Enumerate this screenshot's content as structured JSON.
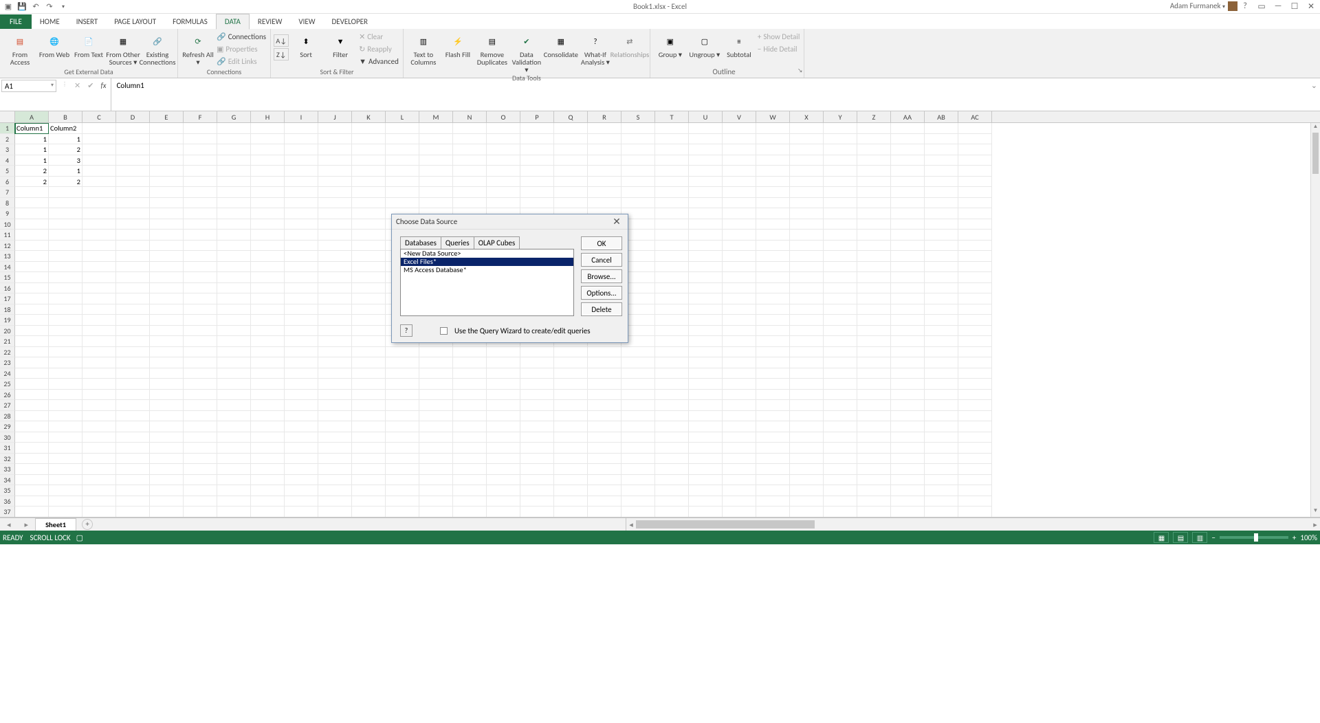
{
  "title": "Book1.xlsx - Excel",
  "user": "Adam Furmanek",
  "tabs": [
    "FILE",
    "HOME",
    "INSERT",
    "PAGE LAYOUT",
    "FORMULAS",
    "DATA",
    "REVIEW",
    "VIEW",
    "DEVELOPER"
  ],
  "activeTab": "DATA",
  "ribbon": {
    "getext": {
      "label": "Get External Data",
      "btns": [
        "From Access",
        "From Web",
        "From Text",
        "From Other Sources ▾",
        "Existing Connections"
      ]
    },
    "conn": {
      "label": "Connections",
      "refresh": "Refresh All ▾",
      "items": [
        "Connections",
        "Properties",
        "Edit Links"
      ]
    },
    "sort": {
      "label": "Sort & Filter",
      "sort": "Sort",
      "filter": "Filter",
      "items": [
        "Clear",
        "Reapply",
        "Advanced"
      ]
    },
    "tools": {
      "label": "Data Tools",
      "btns": [
        "Text to Columns",
        "Flash Fill",
        "Remove Duplicates",
        "Data Validation ▾",
        "Consolidate",
        "What-If Analysis ▾",
        "Relationships"
      ]
    },
    "outline": {
      "label": "Outline",
      "btns": [
        "Group ▾",
        "Ungroup ▾",
        "Subtotal"
      ],
      "items": [
        "Show Detail",
        "Hide Detail"
      ]
    }
  },
  "nameBox": "A1",
  "formula": "Column1",
  "columns": [
    "A",
    "B",
    "C",
    "D",
    "E",
    "F",
    "G",
    "H",
    "I",
    "J",
    "K",
    "L",
    "M",
    "N",
    "O",
    "P",
    "Q",
    "R",
    "S",
    "T",
    "U",
    "V",
    "W",
    "X",
    "Y",
    "Z",
    "AA",
    "AB",
    "AC"
  ],
  "rowCount": 37,
  "data": {
    "1": {
      "A": "Column1",
      "B": "Column2"
    },
    "2": {
      "A": "1",
      "B": "1"
    },
    "3": {
      "A": "1",
      "B": "2"
    },
    "4": {
      "A": "1",
      "B": "3"
    },
    "5": {
      "A": "2",
      "B": "1"
    },
    "6": {
      "A": "2",
      "B": "2"
    }
  },
  "sheetTab": "Sheet1",
  "status": {
    "ready": "READY",
    "scroll": "SCROLL LOCK",
    "zoom": "100%"
  },
  "dialog": {
    "title": "Choose Data Source",
    "tabs": [
      "Databases",
      "Queries",
      "OLAP Cubes"
    ],
    "activeTab": "Databases",
    "items": [
      "<New Data Source>",
      "Excel Files*",
      "MS Access Database*"
    ],
    "selectedItem": "Excel Files*",
    "buttons": [
      "OK",
      "Cancel",
      "Browse...",
      "Options...",
      "Delete"
    ],
    "checkbox": "Use the Query Wizard to create/edit queries"
  }
}
